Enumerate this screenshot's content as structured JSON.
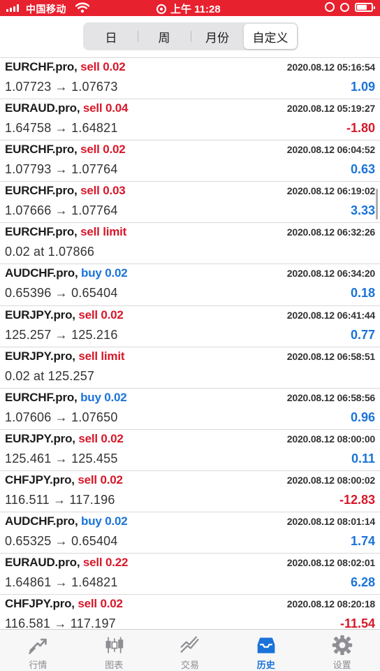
{
  "status_bar": {
    "carrier": "中国移动",
    "time": "上午 11:28"
  },
  "segments": [
    {
      "label": "日",
      "active": false
    },
    {
      "label": "周",
      "active": false
    },
    {
      "label": "月份",
      "active": false
    },
    {
      "label": "自定义",
      "active": true
    }
  ],
  "trades": [
    {
      "symbol": "EURCHF.pro,",
      "side": "sell",
      "detail": "sell 0.02",
      "time": "2020.08.12 05:16:54",
      "prices": "1.07723 → 1.07673",
      "profit": "1.09"
    },
    {
      "symbol": "EURAUD.pro,",
      "side": "sell",
      "detail": "sell 0.04",
      "time": "2020.08.12 05:19:27",
      "prices": "1.64758 → 1.64821",
      "profit": "-1.80"
    },
    {
      "symbol": "EURCHF.pro,",
      "side": "sell",
      "detail": "sell 0.02",
      "time": "2020.08.12 06:04:52",
      "prices": "1.07793 → 1.07764",
      "profit": "0.63"
    },
    {
      "symbol": "EURCHF.pro,",
      "side": "sell",
      "detail": "sell 0.03",
      "time": "2020.08.12 06:19:02",
      "prices": "1.07666 → 1.07764",
      "profit": "3.33"
    },
    {
      "symbol": "EURCHF.pro,",
      "side": "sell",
      "detail": "sell limit",
      "time": "2020.08.12 06:32:26",
      "prices": "0.02 at 1.07866",
      "profit": ""
    },
    {
      "symbol": "AUDCHF.pro,",
      "side": "buy",
      "detail": "buy 0.02",
      "time": "2020.08.12 06:34:20",
      "prices": "0.65396 → 0.65404",
      "profit": "0.18"
    },
    {
      "symbol": "EURJPY.pro,",
      "side": "sell",
      "detail": "sell 0.02",
      "time": "2020.08.12 06:41:44",
      "prices": "125.257 → 125.216",
      "profit": "0.77"
    },
    {
      "symbol": "EURJPY.pro,",
      "side": "sell",
      "detail": "sell limit",
      "time": "2020.08.12 06:58:51",
      "prices": "0.02 at 125.257",
      "profit": ""
    },
    {
      "symbol": "EURCHF.pro,",
      "side": "buy",
      "detail": "buy 0.02",
      "time": "2020.08.12 06:58:56",
      "prices": "1.07606 → 1.07650",
      "profit": "0.96"
    },
    {
      "symbol": "EURJPY.pro,",
      "side": "sell",
      "detail": "sell 0.02",
      "time": "2020.08.12 08:00:00",
      "prices": "125.461 → 125.455",
      "profit": "0.11"
    },
    {
      "symbol": "CHFJPY.pro,",
      "side": "sell",
      "detail": "sell 0.02",
      "time": "2020.08.12 08:00:02",
      "prices": "116.511 → 117.196",
      "profit": "-12.83"
    },
    {
      "symbol": "AUDCHF.pro,",
      "side": "buy",
      "detail": "buy 0.02",
      "time": "2020.08.12 08:01:14",
      "prices": "0.65325 → 0.65404",
      "profit": "1.74"
    },
    {
      "symbol": "EURAUD.pro,",
      "side": "sell",
      "detail": "sell 0.22",
      "time": "2020.08.12 08:02:01",
      "prices": "1.64861 → 1.64821",
      "profit": "6.28"
    },
    {
      "symbol": "CHFJPY.pro,",
      "side": "sell",
      "detail": "sell 0.02",
      "time": "2020.08.12 08:20:18",
      "prices": "116.581 → 117.197",
      "profit": "-11.54"
    }
  ],
  "tabs": [
    {
      "label": "行情",
      "icon": "quotes-icon",
      "active": false
    },
    {
      "label": "图表",
      "icon": "chart-icon",
      "active": false
    },
    {
      "label": "交易",
      "icon": "trade-icon",
      "active": false
    },
    {
      "label": "历史",
      "icon": "history-icon",
      "active": true
    },
    {
      "label": "设置",
      "icon": "settings-icon",
      "active": false
    }
  ],
  "colors": {
    "status_bar_bg": "#e8212f",
    "sell": "#d7182a",
    "buy": "#1a73d9",
    "profit_positive": "#1a73d9",
    "profit_negative": "#d7182a",
    "tab_active": "#1a73d9",
    "tab_inactive": "#8e8e93"
  }
}
